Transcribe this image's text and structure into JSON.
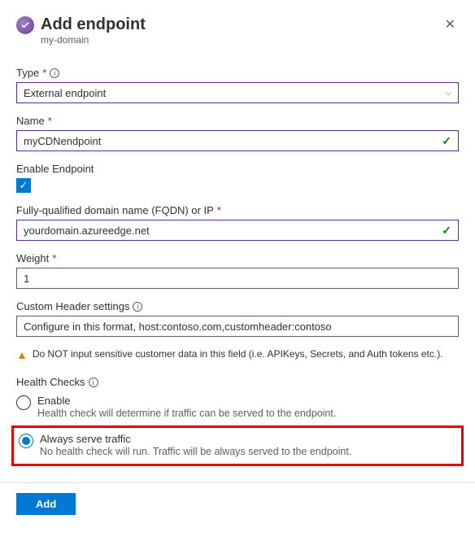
{
  "header": {
    "title": "Add endpoint",
    "subtitle": "my-domain",
    "close_icon": "close"
  },
  "type": {
    "label": "Type",
    "required": "*",
    "value": "External endpoint"
  },
  "name": {
    "label": "Name",
    "required": "*",
    "value": "myCDNendpoint"
  },
  "enable": {
    "label": "Enable Endpoint",
    "checked": true
  },
  "fqdn": {
    "label": "Fully-qualified domain name (FQDN) or IP",
    "required": "*",
    "value": "yourdomain.azureedge.net"
  },
  "weight": {
    "label": "Weight",
    "required": "*",
    "value": "1"
  },
  "custom_header": {
    "label": "Custom Header settings",
    "placeholder": "Configure in this format, host:contoso.com,customheader:contoso"
  },
  "warning": "Do NOT input sensitive customer data in this field (i.e. APIKeys, Secrets, and Auth tokens etc.).",
  "health": {
    "label": "Health Checks",
    "options": [
      {
        "label": "Enable",
        "desc": "Health check will determine if traffic can be served to the endpoint.",
        "selected": false
      },
      {
        "label": "Always serve traffic",
        "desc": "No health check will run. Traffic will be always served to the endpoint.",
        "selected": true
      }
    ]
  },
  "footer": {
    "add": "Add"
  }
}
